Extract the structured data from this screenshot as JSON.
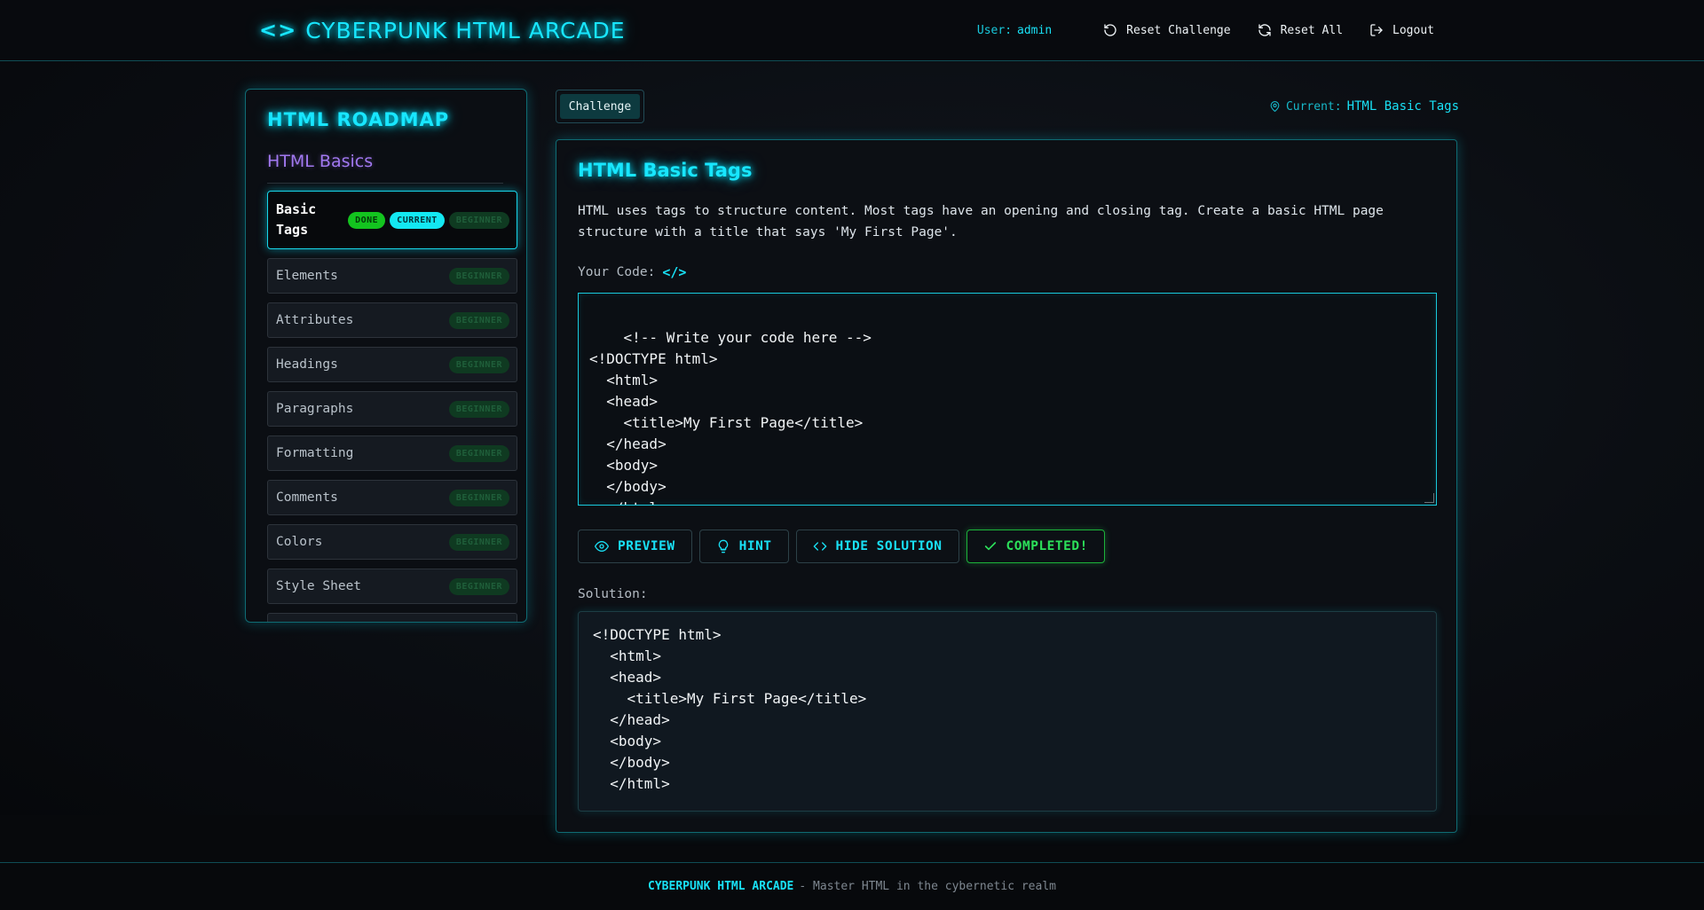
{
  "header": {
    "brand": "CYBERPUNK HTML ARCADE",
    "brand_icon": "code-icon",
    "user_label": "User:",
    "user_name": "admin",
    "reset_challenge": "Reset Challenge",
    "reset_all": "Reset All",
    "logout": "Logout"
  },
  "sidebar": {
    "title": "HTML ROADMAP",
    "section": "HTML Basics",
    "items": [
      {
        "label": "Basic Tags",
        "badges": [
          "DONE",
          "CURRENT",
          "BEGINNER"
        ]
      },
      {
        "label": "Elements",
        "badge": "BEGINNER"
      },
      {
        "label": "Attributes",
        "badge": "BEGINNER"
      },
      {
        "label": "Headings",
        "badge": "BEGINNER"
      },
      {
        "label": "Paragraphs",
        "badge": "BEGINNER"
      },
      {
        "label": "Formatting",
        "badge": "BEGINNER"
      },
      {
        "label": "Comments",
        "badge": "BEGINNER"
      },
      {
        "label": "Colors",
        "badge": "BEGINNER"
      },
      {
        "label": "Style Sheet",
        "badge": "BEGINNER"
      }
    ]
  },
  "tabs": {
    "challenge": "Challenge"
  },
  "current": {
    "label": "Current:",
    "value": "HTML Basic Tags"
  },
  "challenge": {
    "title": "HTML Basic Tags",
    "description": "HTML uses tags to structure content. Most tags have an opening and closing tag. Create a basic HTML page structure with a title that says 'My First Page'.",
    "code_label": "Your Code:",
    "code": "<!-- Write your code here -->\n<!DOCTYPE html>\n  <html>\n  <head>\n    <title>My First Page</title>\n  </head>\n  <body>\n  </body>\n  </html>",
    "buttons": {
      "preview": "PREVIEW",
      "hint": "HINT",
      "hide_solution": "HIDE SOLUTION",
      "completed": "COMPLETED!"
    },
    "solution_label": "Solution:",
    "solution": "<!DOCTYPE html>\n  <html>\n  <head>\n    <title>My First Page</title>\n  </head>\n  <body>\n  </body>\n  </html>"
  },
  "footer": {
    "brand": "CYBERPUNK HTML ARCADE",
    "tagline": "- Master HTML in the cybernetic realm"
  },
  "colors": {
    "accent": "#19e0f5",
    "purple": "#a178f0",
    "success": "#2ce05a"
  }
}
